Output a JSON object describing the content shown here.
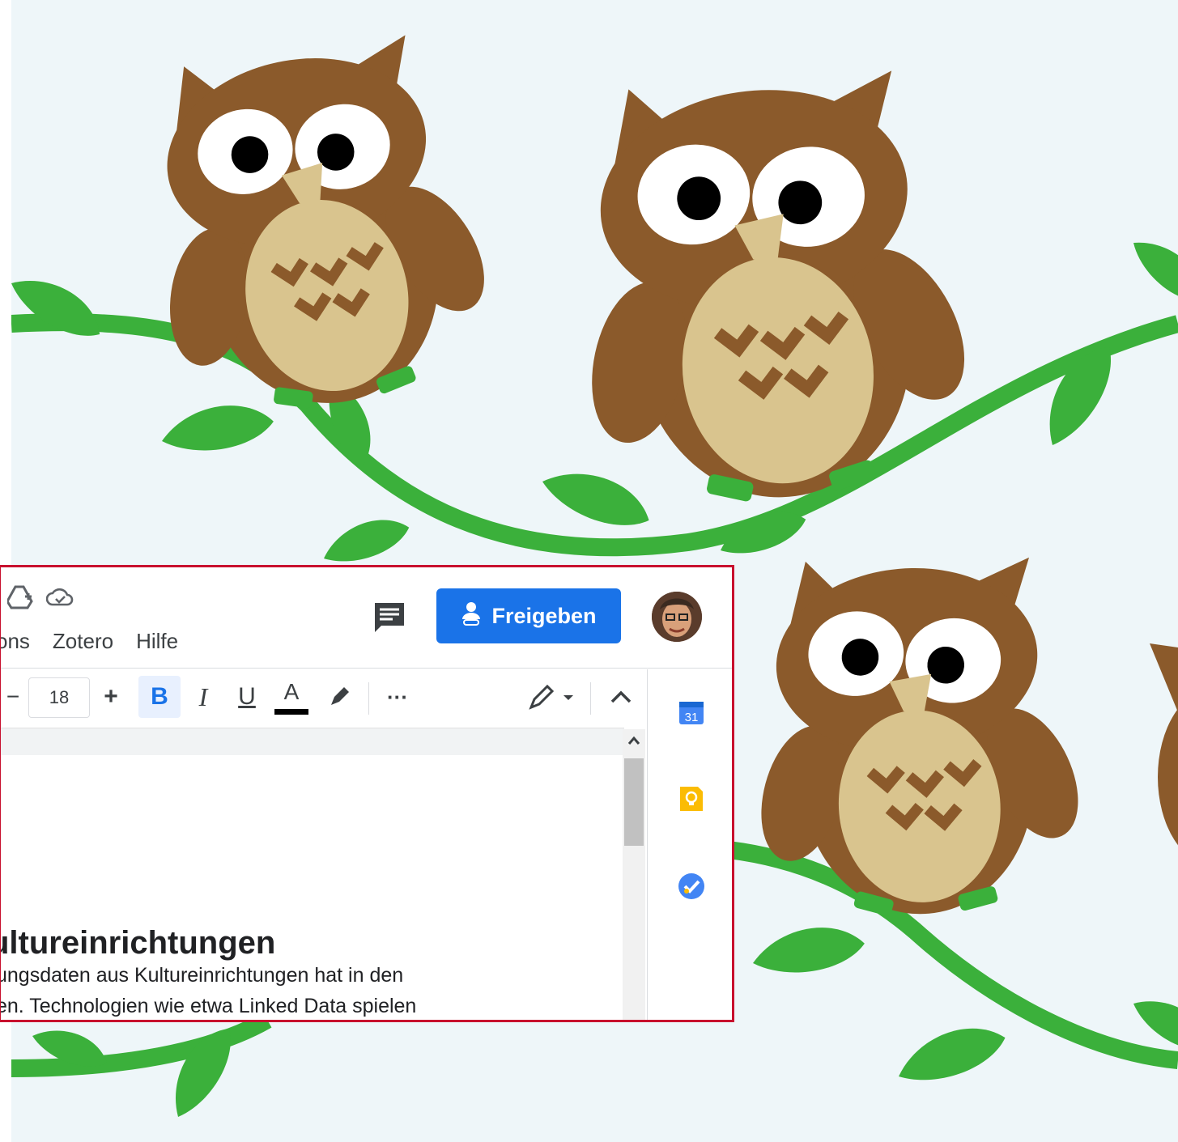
{
  "colors": {
    "background": "#eef6f9",
    "vine": "#3bb03b",
    "owl_body": "#8b5a2b",
    "owl_belly": "#d9c48e",
    "accent_blue": "#1a73e8",
    "window_border": "#c8102e"
  },
  "background_art": {
    "icons": [
      "owl-icon",
      "vine-icon",
      "leaf-icon"
    ]
  },
  "titlebar": {
    "icons": [
      "drive-add-icon",
      "cloud-saved-icon"
    ]
  },
  "menu": {
    "items": [
      "ons",
      "Zotero",
      "Hilfe"
    ]
  },
  "header": {
    "share_label": "Freigeben",
    "comment_icon": "comment-icon",
    "avatar_icon": "avatar"
  },
  "toolbar": {
    "decrease_label": "−",
    "font_size": "18",
    "increase_label": "+",
    "bold_label": "B",
    "italic_label": "I",
    "underline_label": "U",
    "text_color_label": "A",
    "more_label": "···"
  },
  "document": {
    "heading": "ultureinrichtungen",
    "lines": [
      "ungsdaten aus Kultureinrichtungen hat in den",
      "en. Technologien wie etwa Linked Data spielen"
    ]
  },
  "sidepanel": {
    "calendar_day": "31",
    "icons": [
      "calendar-icon",
      "keep-icon",
      "tasks-icon"
    ]
  }
}
